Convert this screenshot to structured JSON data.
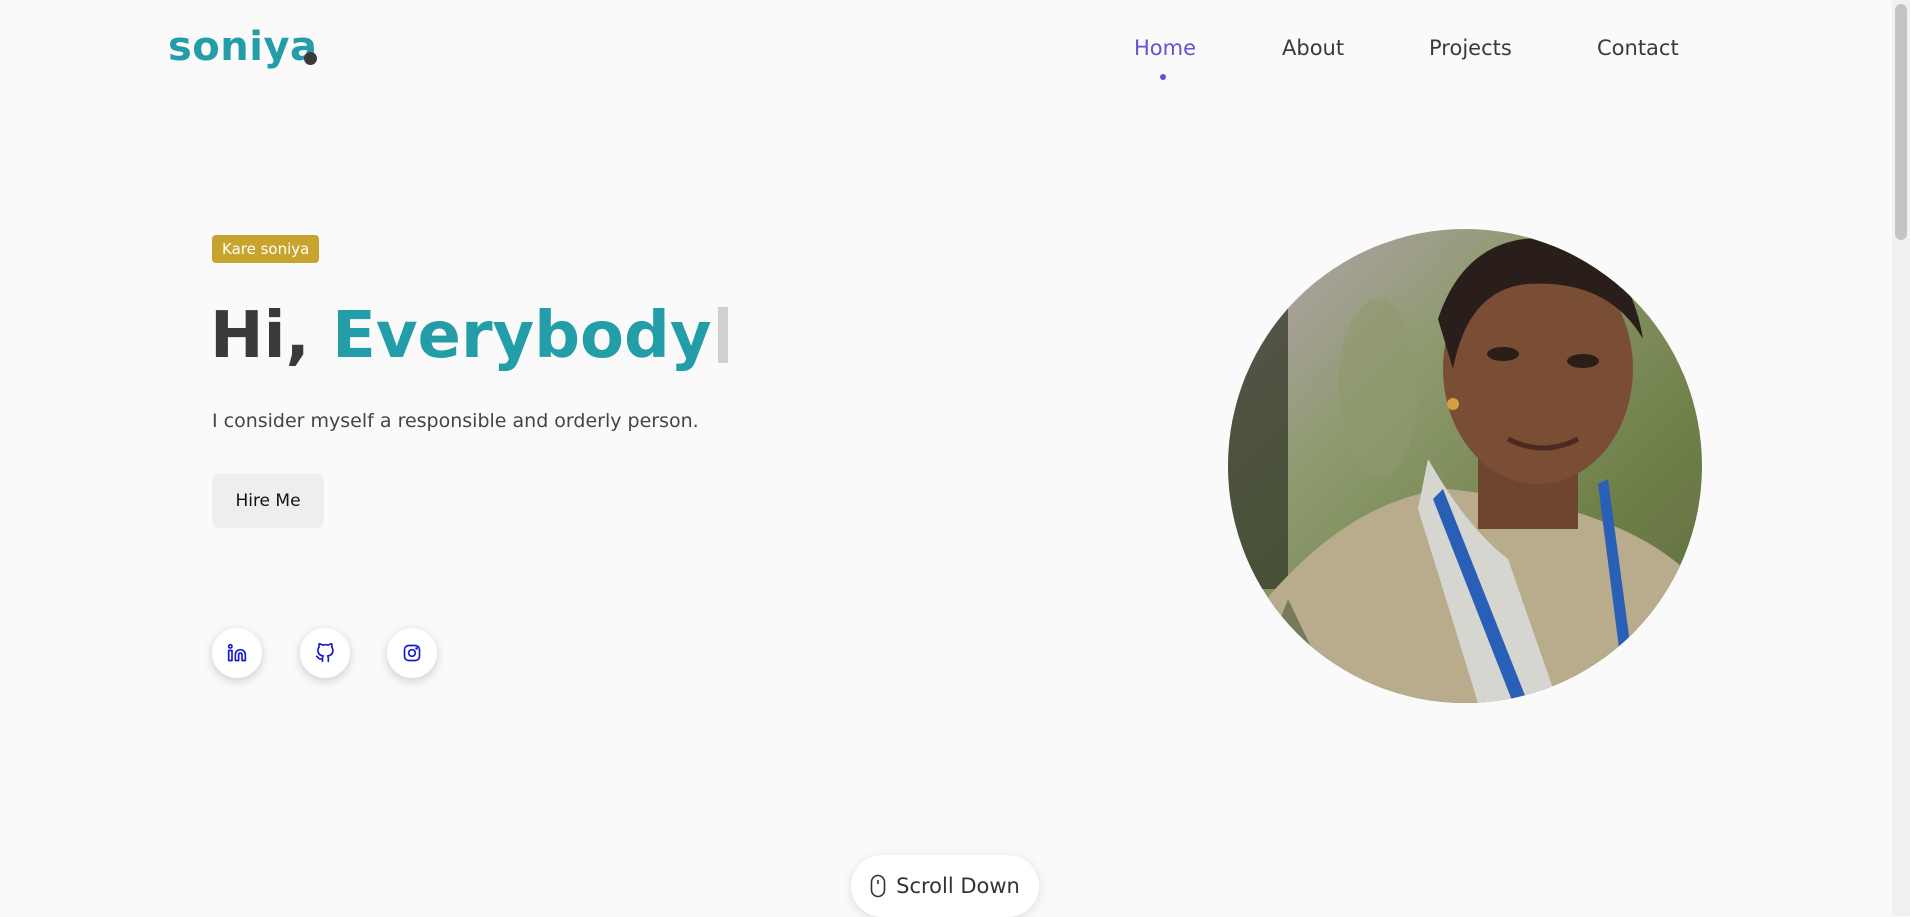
{
  "logo": {
    "text": "soniya"
  },
  "nav": {
    "items": [
      "Home",
      "About",
      "Projects",
      "Contact"
    ],
    "active": "Home"
  },
  "hero": {
    "badge": "Kare soniya",
    "greeting": "Hi,",
    "accent_word": "Everybody",
    "tagline": "I consider myself a responsible and orderly person.",
    "cta_label": "Hire Me"
  },
  "social": {
    "icons": [
      "linkedin-icon",
      "github-icon",
      "instagram-icon"
    ]
  },
  "scroll": {
    "label": "Scroll Down",
    "icon": "mouse-icon"
  },
  "colors": {
    "accent": "#239ea8",
    "nav_active": "#6a4fd0",
    "badge": "#c8a42e",
    "social_icon": "#1a1acc"
  }
}
